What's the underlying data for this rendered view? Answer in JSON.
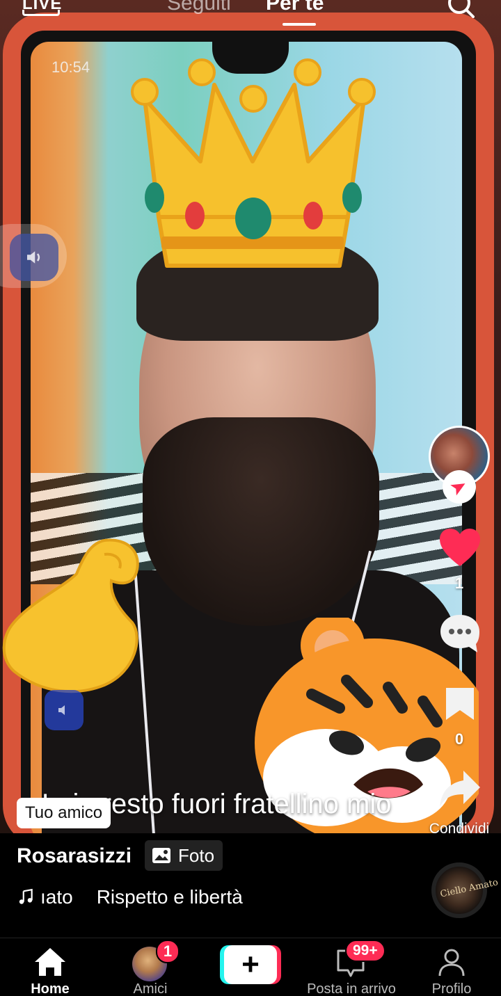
{
  "top_nav": {
    "live_label": "LIVE",
    "tabs": [
      {
        "label": "Seguiti",
        "active": false
      },
      {
        "label": "Per te",
        "active": true
      }
    ],
    "search_icon": "search-icon"
  },
  "video": {
    "status_time": "10:54",
    "overlay_caption": "Lui presto fuori fratellino mio",
    "stickers": [
      "crown",
      "flexed-biceps",
      "tiger-face"
    ]
  },
  "actions": {
    "like_count": "1",
    "bookmark_count": "0",
    "share_label": "Condividi"
  },
  "post": {
    "friend_tag": "Tuo amico",
    "username": "Rosarasizzi",
    "badge_label": "Foto",
    "music_author": "ıato",
    "music_title": "Rispetto e libertà",
    "disc_text": "Ciello Amato"
  },
  "tabbar": {
    "home": "Home",
    "friends": "Amici",
    "friends_badge": "1",
    "inbox": "Posta in arrivo",
    "inbox_badge": "99+",
    "profile": "Profilo"
  },
  "colors": {
    "accent_red": "#fe2c55",
    "accent_cyan": "#25f4ee",
    "like_red": "#fe2c55",
    "phone_frame": "#d8553a"
  }
}
